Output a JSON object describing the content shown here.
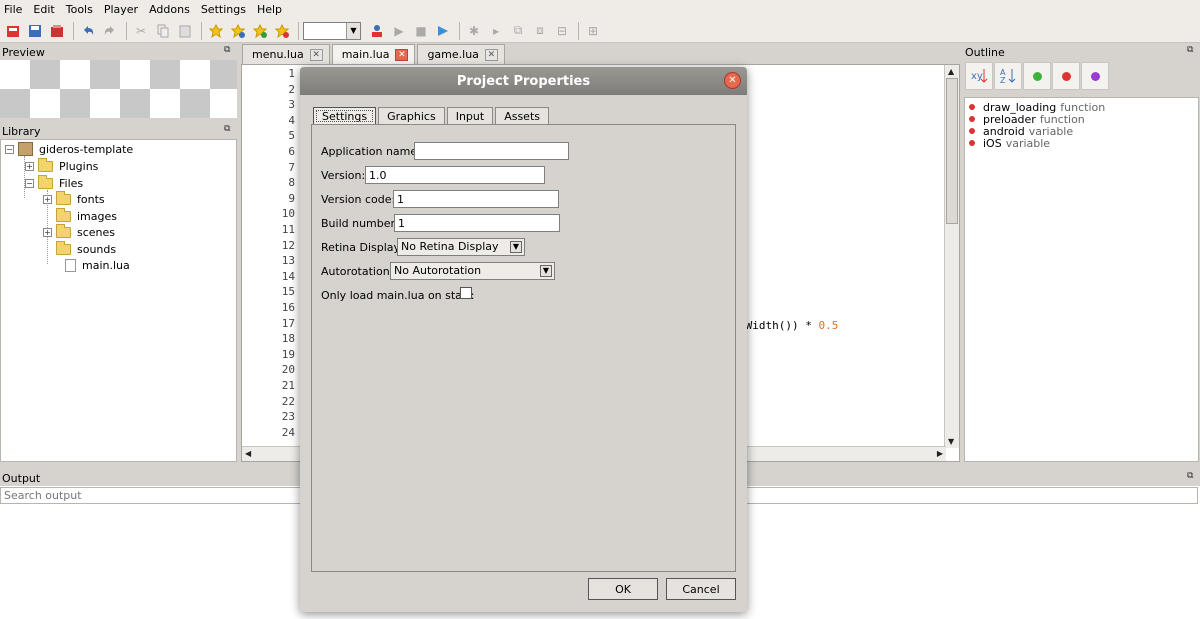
{
  "menu": [
    "File",
    "Edit",
    "Tools",
    "Player",
    "Addons",
    "Settings",
    "Help"
  ],
  "toolbar": {
    "icons": [
      "new-project-icon",
      "save-icon",
      "save-all-icon",
      "undo-icon",
      "redo-icon",
      "cut-icon",
      "copy-icon",
      "paste-icon",
      "bookmark-toggle-icon",
      "bookmark-next-icon",
      "bookmark-prev-icon",
      "bookmark-clear-icon",
      "start-player-icon",
      "play-icon",
      "stop-icon",
      "export-icon",
      "debug-icon",
      "step-icon",
      "step-over-icon",
      "step-out-icon",
      "step-return-icon",
      "project-properties-icon"
    ],
    "player_combo_value": ""
  },
  "preview": {
    "title": "Preview"
  },
  "library": {
    "title": "Library",
    "root": "gideros-template",
    "items": [
      {
        "label": "Plugins"
      },
      {
        "label": "Files"
      },
      {
        "label": "fonts"
      },
      {
        "label": "images"
      },
      {
        "label": "scenes"
      },
      {
        "label": "sounds"
      },
      {
        "label": "main.lua"
      }
    ]
  },
  "tabs": [
    {
      "label": "menu.lua"
    },
    {
      "label": "main.lua"
    },
    {
      "label": "game.lua"
    }
  ],
  "editor": {
    "line_numbers": [
      "1",
      "2",
      "3",
      "4",
      "5",
      "6",
      "7",
      "8",
      "9",
      "10",
      "11",
      "12",
      "13",
      "14",
      "15",
      "16",
      "17",
      "18",
      "19",
      "20",
      "21",
      "22",
      "23",
      "24"
    ],
    "visible_code_text": "tWidth()) * ",
    "visible_code_number": "0.5"
  },
  "outline": {
    "title": "Outline",
    "items": [
      {
        "name": "draw_loading",
        "type": "function"
      },
      {
        "name": "preloader",
        "type": "function"
      },
      {
        "name": "android",
        "type": "variable"
      },
      {
        "name": "iOS",
        "type": "variable"
      }
    ]
  },
  "output": {
    "title": "Output",
    "search_placeholder": "Search output"
  },
  "dialog": {
    "title": "Project Properties",
    "tabs": [
      "Settings",
      "Graphics",
      "Input",
      "Assets"
    ],
    "fields": {
      "app_name_label": "Application name:",
      "app_name_value": "",
      "version_label": "Version:",
      "version_value": "1.0",
      "version_code_label": "Version code:",
      "version_code_value": "1",
      "build_number_label": "Build number:",
      "build_number_value": "1",
      "retina_label": "Retina Display:",
      "retina_value": "No Retina Display",
      "autorotation_label": "Autorotation:",
      "autorotation_value": "No Autorotation",
      "only_main_label": "Only load main.lua on start:",
      "only_main_checked": false
    },
    "ok_label": "OK",
    "cancel_label": "Cancel"
  },
  "colors": {
    "accent_close": "#e56a4c",
    "outline_dot": "#dd3333",
    "code_number": "#e07020"
  }
}
